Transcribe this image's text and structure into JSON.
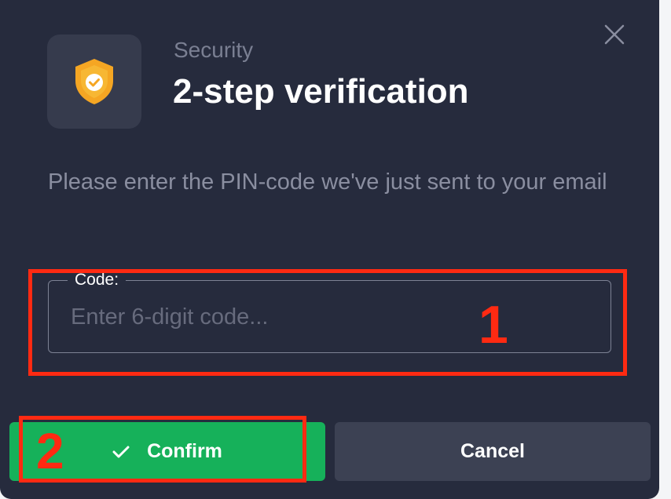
{
  "dialog": {
    "eyebrow": "Security",
    "title": "2-step verification",
    "description": "Please enter the PIN-code we've just sent to your email",
    "close_icon": "close-icon",
    "header_icon": "shield-check-icon"
  },
  "code_field": {
    "label": "Code:",
    "placeholder": "Enter 6-digit code...",
    "value": ""
  },
  "buttons": {
    "confirm_label": "Confirm",
    "confirm_icon": "check-icon",
    "cancel_label": "Cancel"
  },
  "annotations": [
    {
      "number": "1"
    },
    {
      "number": "2"
    }
  ],
  "colors": {
    "background": "#262b3d",
    "confirm": "#16b15a",
    "cancel": "#3c4153",
    "annotation": "#ff2a12",
    "shield": "#f5a623"
  }
}
